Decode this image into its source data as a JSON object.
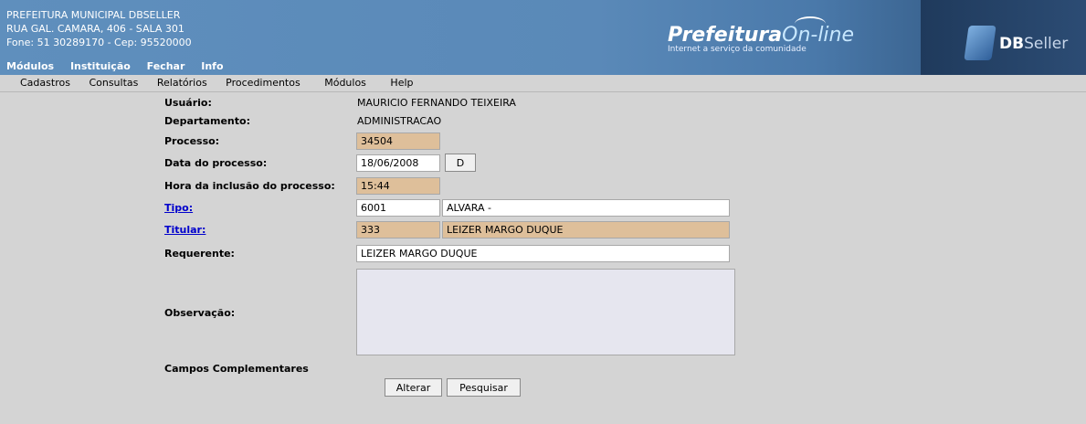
{
  "header": {
    "org_line1": "PREFEITURA MUNICIPAL DBSELLER",
    "org_line2": "RUA GAL. CAMARA, 406 - SALA 301",
    "org_line3": "Fone: 51 30289170  -  Cep: 95520000",
    "top_menu": [
      "Módulos",
      "Instituição",
      "Fechar",
      "Info"
    ],
    "logo_main": "Prefeitura",
    "logo_online": "On-line",
    "logo_tagline": "Internet a serviço da comunidade",
    "brand_db": "DB",
    "brand_seller": "Seller"
  },
  "menubar": [
    "Cadastros",
    "Consultas",
    "Relatórios",
    "Procedimentos",
    "Módulos",
    "Help"
  ],
  "form": {
    "usuario_label": "Usuário:",
    "usuario_value": "MAURICIO FERNANDO TEIXEIRA",
    "departamento_label": "Departamento:",
    "departamento_value": "ADMINISTRACAO",
    "processo_label": "Processo:",
    "processo_value": "34504",
    "data_label": "Data do processo:",
    "data_value": "18/06/2008",
    "data_button": "D",
    "hora_label": "Hora da inclusão do processo:",
    "hora_value": "15:44",
    "tipo_label": "Tipo:",
    "tipo_code": "6001",
    "tipo_desc": "ALVARA -",
    "titular_label": "Titular:",
    "titular_code": "333",
    "titular_name": "LEIZER MARGO DUQUE",
    "requerente_label": "Requerente:",
    "requerente_value": "LEIZER MARGO DUQUE",
    "observacao_label": "Observação:",
    "observacao_value": "",
    "campos_label": "Campos Complementares",
    "alterar_button": "Alterar",
    "pesquisar_button": "Pesquisar"
  }
}
